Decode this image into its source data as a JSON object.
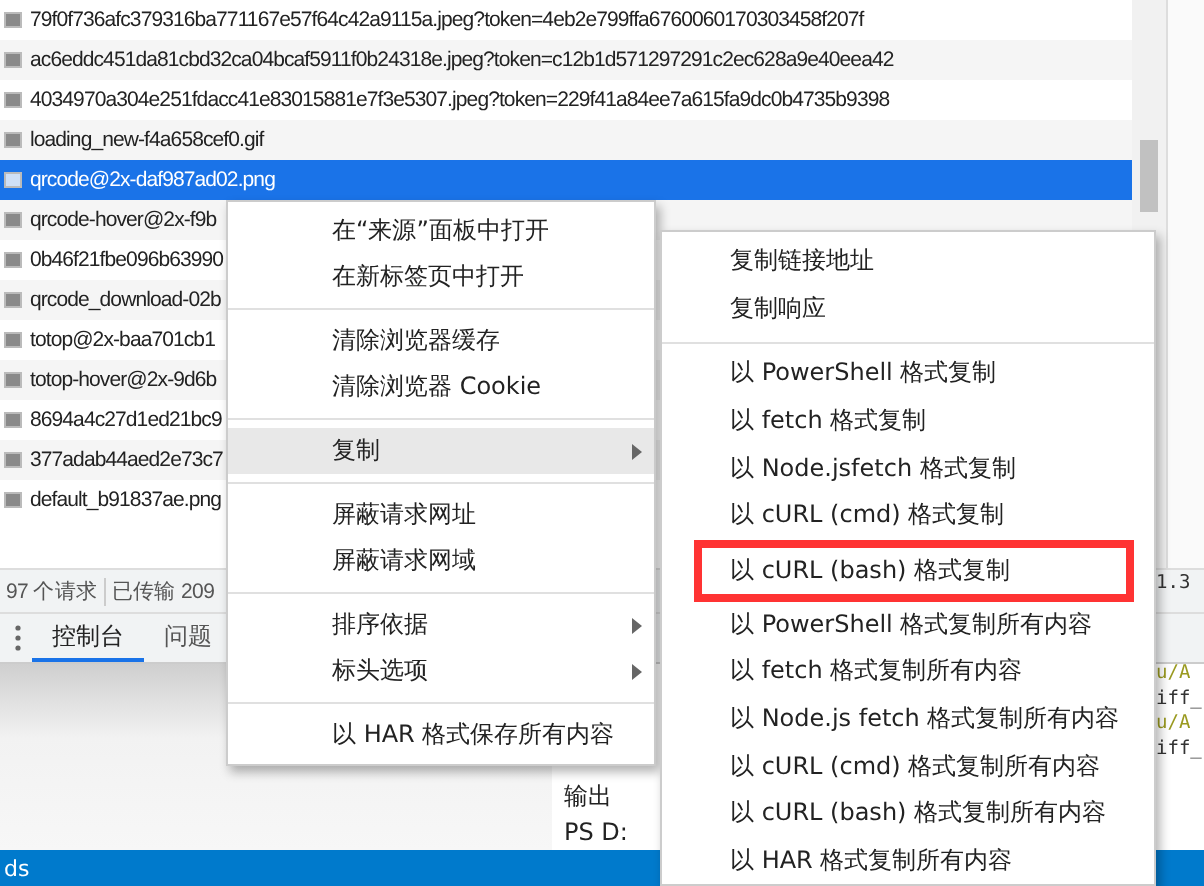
{
  "requests": [
    {
      "name": "79f0f736afc379316ba771167e57f64c42a9115a.jpeg?token=4eb2e799ffa6760060170303458f207f",
      "selected": false
    },
    {
      "name": "ac6eddc451da81cbd32ca04bcaf5911f0b24318e.jpeg?token=c12b1d571297291c2ec628a9e40eea42",
      "selected": false
    },
    {
      "name": "4034970a304e251fdacc41e83015881e7f3e5307.jpeg?token=229f41a84ee7a615fa9dc0b4735b9398",
      "selected": false
    },
    {
      "name": "loading_new-f4a658cef0.gif",
      "selected": false
    },
    {
      "name": "qrcode@2x-daf987ad02.png",
      "selected": true
    },
    {
      "name": "qrcode-hover@2x-f9b",
      "selected": false
    },
    {
      "name": "0b46f21fbe096b63990",
      "selected": false
    },
    {
      "name": "qrcode_download-02b",
      "selected": false
    },
    {
      "name": "totop@2x-baa701cb1",
      "selected": false
    },
    {
      "name": "totop-hover@2x-9d6b",
      "selected": false
    },
    {
      "name": "8694a4c27d1ed21bc9",
      "selected": false
    },
    {
      "name": "377adab44aed2e73c7",
      "selected": false
    },
    {
      "name": "default_b91837ae.png",
      "selected": false
    }
  ],
  "status_bar": [
    "97 个请求",
    "已传输 209"
  ],
  "drawer_tabs": [
    {
      "label": "控制台",
      "selected": true
    },
    {
      "label": "问题",
      "selected": false
    }
  ],
  "terminal": {
    "lines": [
      {
        "text": "1.3",
        "kind": "plain"
      },
      {
        "text": "u/A",
        "kind": "path"
      },
      {
        "text": "iff_",
        "kind": "plain"
      },
      {
        "text": "u/A",
        "kind": "path"
      },
      {
        "text": "iff_",
        "kind": "plain"
      }
    ],
    "output": [
      "输出",
      "PS D:"
    ]
  },
  "taskbar": {
    "text": "ds"
  },
  "context_menu": {
    "groups": [
      {
        "items": [
          {
            "label": "在“来源”面板中打开",
            "submenu": false,
            "hovered": false
          },
          {
            "label": "在新标签页中打开",
            "submenu": false,
            "hovered": false
          }
        ]
      },
      {
        "items": [
          {
            "label": "清除浏览器缓存",
            "submenu": false,
            "hovered": false
          },
          {
            "label": "清除浏览器 Cookie",
            "submenu": false,
            "hovered": false
          }
        ]
      },
      {
        "items": [
          {
            "label": "复制",
            "submenu": true,
            "hovered": true
          }
        ]
      },
      {
        "items": [
          {
            "label": "屏蔽请求网址",
            "submenu": false,
            "hovered": false
          },
          {
            "label": "屏蔽请求网域",
            "submenu": false,
            "hovered": false
          }
        ]
      },
      {
        "items": [
          {
            "label": "排序依据",
            "submenu": true,
            "hovered": false
          },
          {
            "label": "标头选项",
            "submenu": true,
            "hovered": false
          }
        ]
      },
      {
        "items": [
          {
            "label": "以 HAR 格式保存所有内容",
            "submenu": false,
            "hovered": false
          }
        ]
      }
    ]
  },
  "copy_submenu": {
    "groups": [
      {
        "items": [
          {
            "label": "复制链接地址",
            "highlighted": false
          },
          {
            "label": "复制响应",
            "highlighted": false
          }
        ]
      },
      {
        "items": [
          {
            "label": "以 PowerShell 格式复制",
            "highlighted": false
          },
          {
            "label": "以 fetch 格式复制",
            "highlighted": false
          },
          {
            "label": "以 Node.jsfetch 格式复制",
            "highlighted": false
          },
          {
            "label": "以 cURL (cmd) 格式复制",
            "highlighted": false
          },
          {
            "label": "以 cURL (bash) 格式复制",
            "highlighted": true
          },
          {
            "label": "以 PowerShell 格式复制所有内容",
            "highlighted": false
          },
          {
            "label": "以 fetch 格式复制所有内容",
            "highlighted": false
          },
          {
            "label": "以 Node.js fetch 格式复制所有内容",
            "highlighted": false
          },
          {
            "label": "以 cURL (cmd) 格式复制所有内容",
            "highlighted": false
          },
          {
            "label": "以 cURL (bash) 格式复制所有内容",
            "highlighted": false
          },
          {
            "label": "以 HAR 格式复制所有内容",
            "highlighted": false
          }
        ]
      }
    ]
  }
}
